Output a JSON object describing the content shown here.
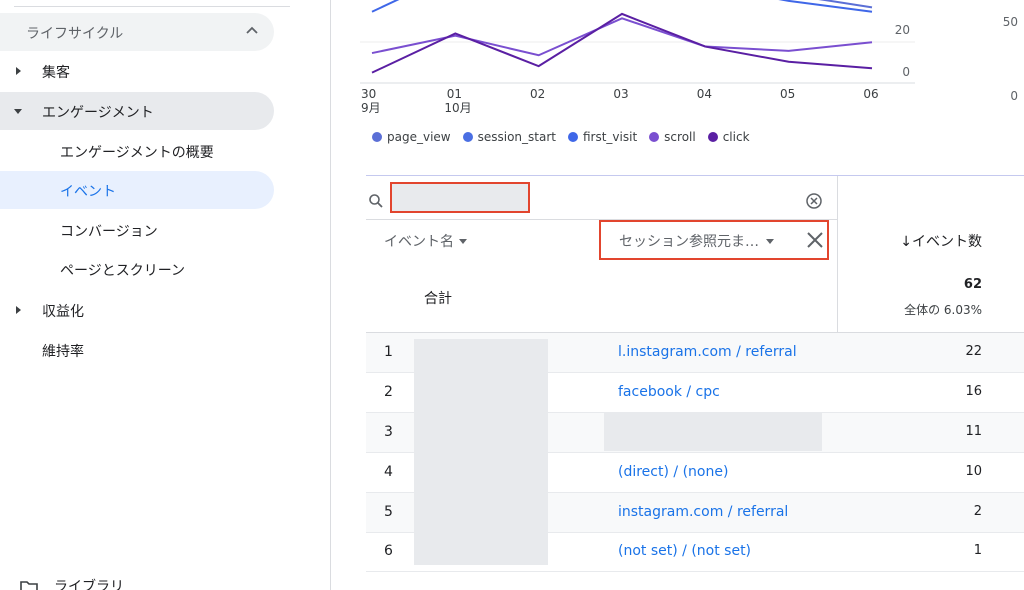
{
  "sidebar": {
    "section": {
      "label": "ライフサイクル"
    },
    "items": [
      {
        "label": "集客"
      },
      {
        "label": "エンゲージメント"
      },
      {
        "label": "エンゲージメントの概要"
      },
      {
        "label": "イベント"
      },
      {
        "label": "コンバージョン"
      },
      {
        "label": "ページとスクリーン"
      },
      {
        "label": "収益化"
      },
      {
        "label": "維持率"
      }
    ],
    "library": {
      "label": "ライブラリ"
    }
  },
  "chart_data": {
    "type": "line",
    "x": [
      "30 9月",
      "01 10月",
      "02",
      "03",
      "04",
      "05",
      "06"
    ],
    "xticks": [
      "30",
      "01",
      "02",
      "03",
      "04",
      "05",
      "06"
    ],
    "xticks_sub": [
      "9月",
      "10月",
      "",
      "",
      "",
      "",
      ""
    ],
    "yticks_left": [
      "0",
      "20"
    ],
    "yticks_right": [
      "0",
      "50"
    ],
    "series": [
      {
        "name": "page_view",
        "color": "#5b6fd6",
        "values": [
          38,
          55,
          43,
          60,
          48,
          38,
          32
        ]
      },
      {
        "name": "session_start",
        "color": "#4a6fe3",
        "values": [
          46,
          64,
          54,
          72,
          60,
          48,
          43
        ]
      },
      {
        "name": "first_visit",
        "color": "#3f67e8",
        "values": [
          30,
          48,
          37,
          54,
          42,
          35,
          30
        ]
      },
      {
        "name": "scroll",
        "color": "#7a4fd0",
        "values": [
          11,
          19,
          10,
          27,
          14,
          12,
          16
        ]
      },
      {
        "name": "click",
        "color": "#5a1fa3",
        "values": [
          2,
          20,
          5,
          29,
          14,
          7,
          4
        ]
      }
    ],
    "ylim": [
      0,
      40
    ]
  },
  "table": {
    "headers": {
      "event_name": "イベント名",
      "dimension": "セッション参照元ま…",
      "count": "↓イベント数"
    },
    "total": {
      "label": "合計",
      "value": "62",
      "sub": "全体の 6.03%"
    },
    "rows": [
      {
        "index": "1",
        "source": "l.instagram.com / referral",
        "count": "22"
      },
      {
        "index": "2",
        "source": "facebook / cpc",
        "count": "16"
      },
      {
        "index": "3",
        "source": "",
        "count": "11"
      },
      {
        "index": "4",
        "source": "(direct) / (none)",
        "count": "10"
      },
      {
        "index": "5",
        "source": "instagram.com / referral",
        "count": "2"
      },
      {
        "index": "6",
        "source": "(not set) / (not set)",
        "count": "1"
      }
    ]
  }
}
